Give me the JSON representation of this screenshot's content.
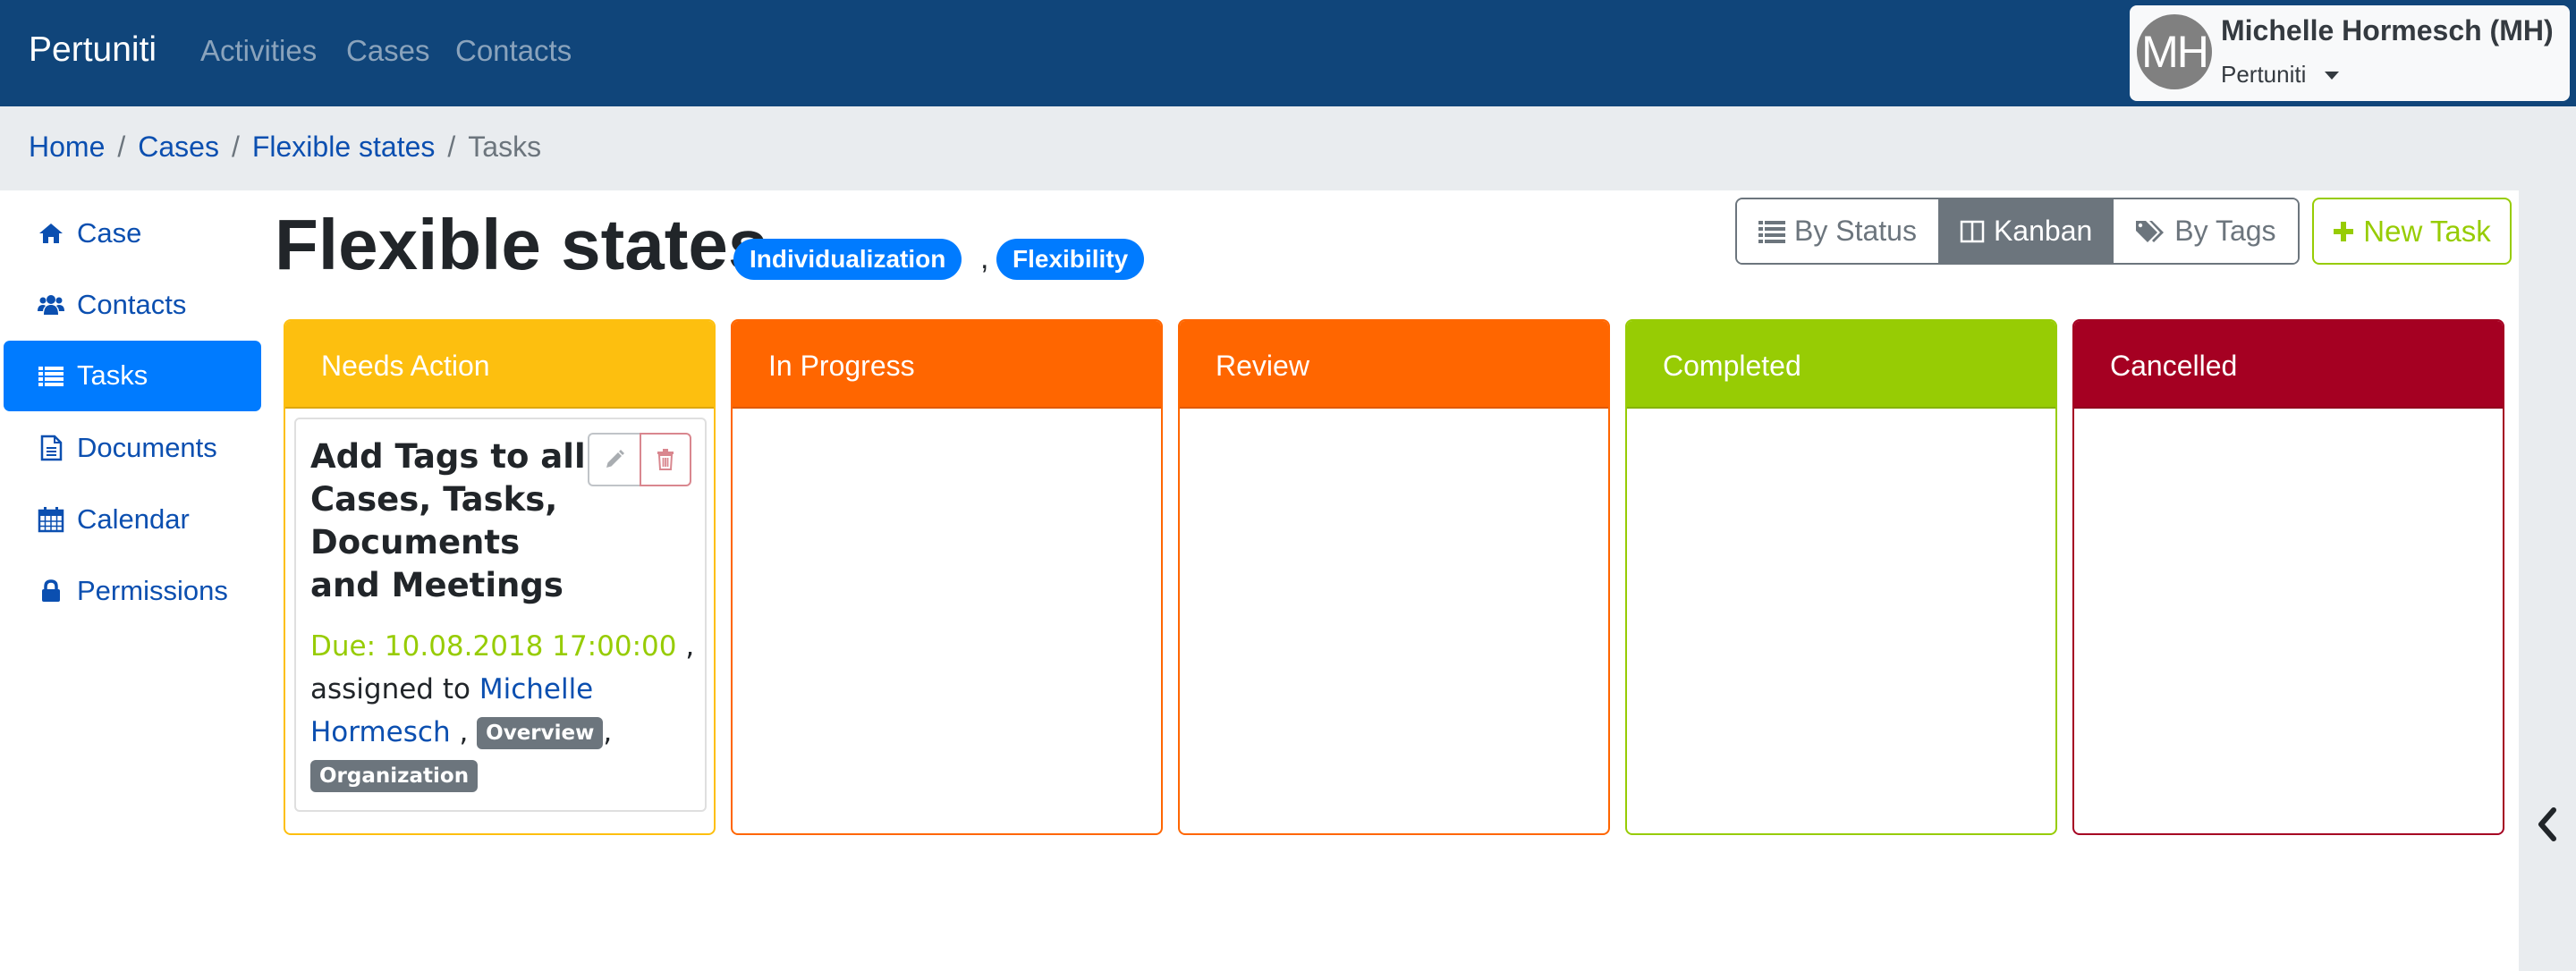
{
  "navbar": {
    "brand": "Pertuniti",
    "links": [
      "Activities",
      "Cases",
      "Contacts"
    ],
    "user": {
      "initials": "MH",
      "name": "Michelle Hormesch (MH)",
      "organization": "Pertuniti"
    },
    "colors": {
      "background": "#10457a"
    }
  },
  "breadcrumb": {
    "items": [
      "Home",
      "Cases",
      "Flexible states"
    ],
    "current": "Tasks",
    "separator": "/"
  },
  "sidebar": {
    "items": [
      {
        "label": "Case",
        "icon": "home-icon"
      },
      {
        "label": "Contacts",
        "icon": "users-icon"
      },
      {
        "label": "Tasks",
        "icon": "list-icon",
        "active": true
      },
      {
        "label": "Documents",
        "icon": "document-icon"
      },
      {
        "label": "Calendar",
        "icon": "calendar-icon"
      },
      {
        "label": "Permissions",
        "icon": "lock-icon"
      }
    ]
  },
  "page": {
    "title": "Flexible states",
    "tags": [
      "Individualization",
      "Flexibility"
    ],
    "tag_separator": ","
  },
  "toolbar": {
    "views": [
      {
        "label": "By Status",
        "icon": "list-icon"
      },
      {
        "label": "Kanban",
        "icon": "columns-icon",
        "active": true
      },
      {
        "label": "By Tags",
        "icon": "tags-icon"
      }
    ],
    "new_task_label": "New Task"
  },
  "kanban": {
    "columns": [
      {
        "title": "Needs Action",
        "color": "#fdbf0f"
      },
      {
        "title": "In Progress",
        "color": "#ff6600"
      },
      {
        "title": "Review",
        "color": "#ff6600"
      },
      {
        "title": "Completed",
        "color": "#97cc04"
      },
      {
        "title": "Cancelled",
        "color": "#a50022"
      }
    ],
    "cards": [
      {
        "column": "Needs Action",
        "title": "Add Tags to all Cases, Tasks, Documents and Meetings",
        "due": "Due: 10.08.2018 17:00:00",
        "assigned_prefix": "assigned to",
        "assignee": "Michelle Hormesch",
        "tags": [
          "Overview",
          "Organization"
        ]
      }
    ]
  }
}
